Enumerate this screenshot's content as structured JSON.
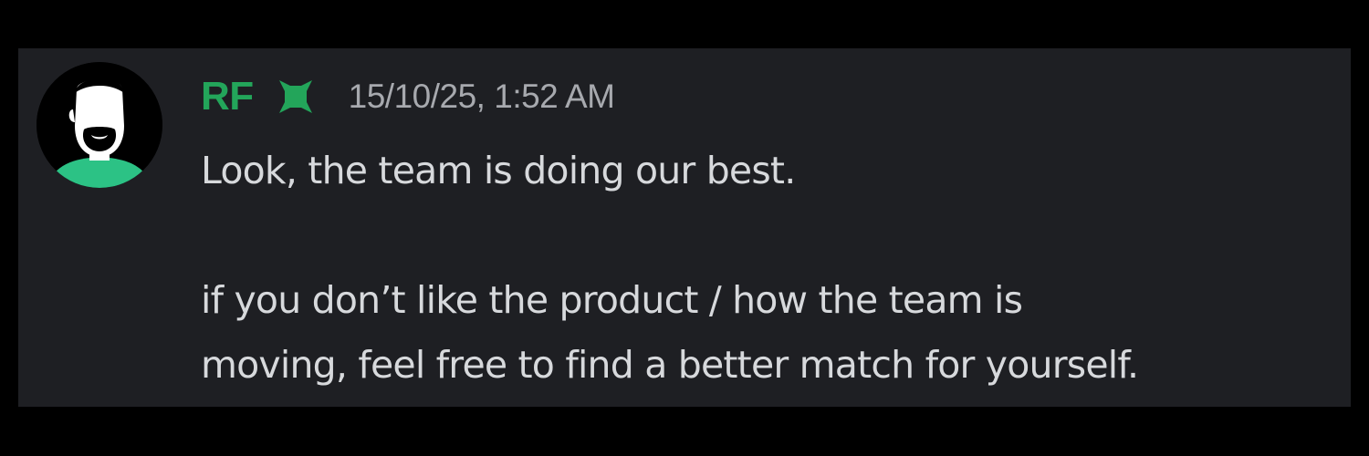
{
  "message": {
    "author": {
      "name": "RF",
      "name_color": "#23a55a",
      "avatar_icon": "profile-avatar-icon",
      "badge_icon": "green-shield-badge-icon"
    },
    "timestamp": "15/10/25, 1:52 AM",
    "lines": [
      "Look, the team is doing our best.",
      "if you don’t like the product / how the team is",
      "moving, feel free to find a better match for yourself."
    ]
  },
  "colors": {
    "page_background": "#000000",
    "card_background": "#1e1f23",
    "accent_green": "#23a55a",
    "text": "#d7d9dc",
    "muted_text": "#a7a9ae"
  }
}
